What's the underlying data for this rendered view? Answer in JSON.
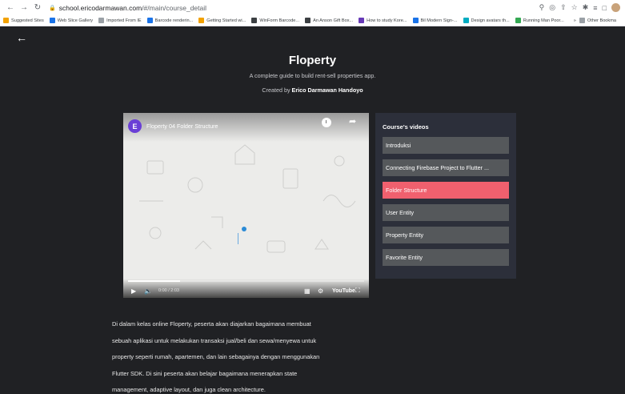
{
  "browser": {
    "url_host": "school.ericodarmawan.com",
    "url_path": "/#/main/course_detail",
    "bookmarks": [
      {
        "label": "Suggested Sites",
        "color": "#f2a100"
      },
      {
        "label": "Web Slice Gallery",
        "color": "#1a73e8"
      },
      {
        "label": "Imported From IE",
        "color": "#9aa0a6"
      },
      {
        "label": "Barcode renderin...",
        "color": "#1a73e8"
      },
      {
        "label": "Getting Started wi...",
        "color": "#f2a100"
      },
      {
        "label": "WinForm Barcode...",
        "color": "#3c4043"
      },
      {
        "label": "An Anson Gift Box...",
        "color": "#3c4043"
      },
      {
        "label": "How to study Kore...",
        "color": "#673ab7"
      },
      {
        "label": "Bil Modern Sign-...",
        "color": "#1a73e8"
      },
      {
        "label": "Design avatars th...",
        "color": "#00acc1"
      },
      {
        "label": "Running Man Poor...",
        "color": "#34a853"
      }
    ],
    "other_bookmarks": "Other Bookma"
  },
  "course": {
    "title": "Floperty",
    "subtitle": "A complete guide to build rent-sell properties app.",
    "byline_prefix": "Created by",
    "author": "Erico Darmawan Handoyo"
  },
  "video": {
    "channel_initial": "E",
    "title": "Floperty 04 Folder Structure",
    "time": "0:00 / 2:03",
    "progress": 0.22,
    "youtube_label": "YouTube"
  },
  "sidebar": {
    "title": "Course's videos",
    "items": [
      {
        "label": "Introduksi",
        "active": false
      },
      {
        "label": "Connecting Firebase Project to Flutter ...",
        "active": false
      },
      {
        "label": "Folder Structure",
        "active": true
      },
      {
        "label": "User Entity",
        "active": false
      },
      {
        "label": "Property Entity",
        "active": false
      },
      {
        "label": "Favorite Entity",
        "active": false
      }
    ]
  },
  "description": {
    "lines": [
      "Di dalam kelas online Floperty, peserta akan diajarkan bagaimana membuat",
      "sebuah aplikasi untuk melakukan transaksi jual/beli dan sewa/menyewa untuk",
      "property seperti rumah, apartemen, dan lain sebagainya dengan menggunakan",
      "Flutter SDK. Di sini peserta akan belajar bagaimana menerapkan state",
      "management, adaptive layout, dan juga clean architecture."
    ]
  },
  "colors": {
    "background": "#202124",
    "panel": "#2c2f3a",
    "item": "#55585b",
    "active_item": "#f0606e"
  }
}
